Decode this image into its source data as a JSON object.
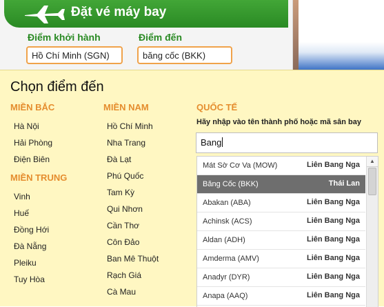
{
  "widget": {
    "title": "Đặt vé máy bay",
    "origin_label": "Điểm khởi hành",
    "origin_value": "Hồ Chí Minh (SGN)",
    "destination_label": "Điểm đến",
    "destination_value": "băng cốc (BKK)"
  },
  "picker": {
    "title": "Chọn điểm đến",
    "north": {
      "heading": "MIỀN BẮC",
      "cities": [
        "Hà Nội",
        "Hải Phòng",
        "Điện Biên"
      ]
    },
    "central": {
      "heading": "MIỀN TRUNG",
      "cities": [
        "Vinh",
        "Huế",
        "Đồng Hới",
        "Đà Nẵng",
        "Pleiku",
        "Tuy Hòa"
      ]
    },
    "south": {
      "heading": "MIỀN NAM",
      "cities": [
        "Hồ Chí Minh",
        "Nha Trang",
        "Đà Lạt",
        "Phú Quốc",
        "Tam Kỳ",
        "Qui Nhơn",
        "Cần Thơ",
        "Côn Đảo",
        "Ban Mê Thuột",
        "Rạch Giá",
        "Cà Mau"
      ]
    },
    "international": {
      "heading": "QUỐC TẾ",
      "hint": "Hãy nhập vào tên thành phố hoặc mã sân bay",
      "search_value": "Bang",
      "results": [
        {
          "name": "Mát Sờ Cơ Va (MOW)",
          "country": "Liên Bang Nga"
        },
        {
          "name": "Băng Cốc (BKK)",
          "country": "Thái Lan"
        },
        {
          "name": "Abakan (ABA)",
          "country": "Liên Bang Nga"
        },
        {
          "name": "Achinsk (ACS)",
          "country": "Liên Bang Nga"
        },
        {
          "name": "Aldan (ADH)",
          "country": "Liên Bang Nga"
        },
        {
          "name": "Amderma (AMV)",
          "country": "Liên Bang Nga"
        },
        {
          "name": "Anadyr (DYR)",
          "country": "Liên Bang Nga"
        },
        {
          "name": "Anapa (AAQ)",
          "country": "Liên Bang Nga"
        }
      ]
    }
  },
  "colors": {
    "header_green": "#2a8a24",
    "accent_orange": "#e58d2e",
    "panel_yellow": "#fff7c2",
    "selected_row": "#6e6e6e"
  }
}
